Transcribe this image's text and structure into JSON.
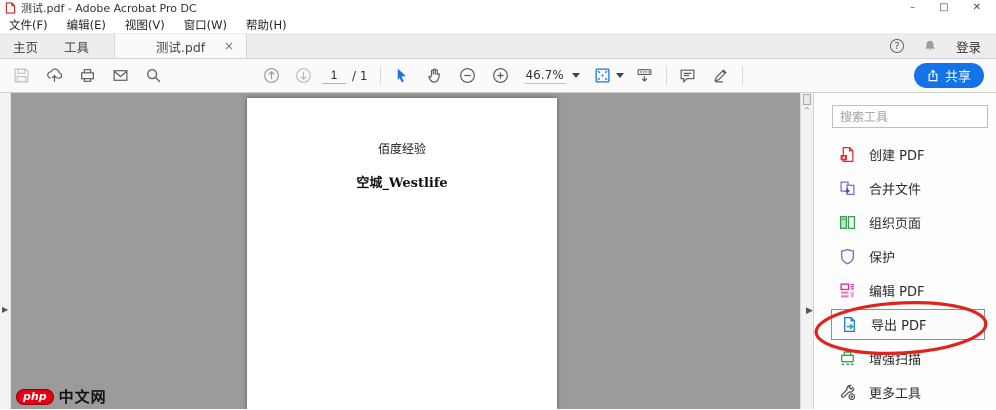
{
  "titlebar": {
    "title": "测试.pdf - Adobe Acrobat Pro DC",
    "minimize": "–",
    "restore": "□",
    "close": "✕"
  },
  "menubar": {
    "items": [
      {
        "label": "文件(F)"
      },
      {
        "label": "编辑(E)"
      },
      {
        "label": "视图(V)"
      },
      {
        "label": "窗口(W)"
      },
      {
        "label": "帮助(H)"
      }
    ]
  },
  "tabbar": {
    "home": "主页",
    "tools": "工具",
    "document_tab": "测试.pdf",
    "tab_close": "×",
    "help": "?",
    "sign_in": "登录"
  },
  "toolbar": {
    "page_current": "1",
    "page_total": "/ 1",
    "zoom_level": "46.7%",
    "share": "共享"
  },
  "document": {
    "title_line": "佰度经验",
    "author_line": "空城_Westlife"
  },
  "right_panel": {
    "search_placeholder": "搜索工具",
    "tools": [
      {
        "label": "创建 PDF"
      },
      {
        "label": "合并文件"
      },
      {
        "label": "组织页面"
      },
      {
        "label": "保护"
      },
      {
        "label": "编辑 PDF"
      },
      {
        "label": "导出 PDF",
        "highlighted": true
      },
      {
        "label": "增强扫描"
      },
      {
        "label": "更多工具"
      }
    ]
  },
  "watermark": {
    "logo": "php",
    "site": "中文网"
  },
  "icons": {
    "panel_expand": "▶",
    "scroll_up": "^"
  },
  "colors": {
    "accent_blue": "#1473E6",
    "circle_red": "#E0231C",
    "doc_gray": "#9B9B9B"
  }
}
